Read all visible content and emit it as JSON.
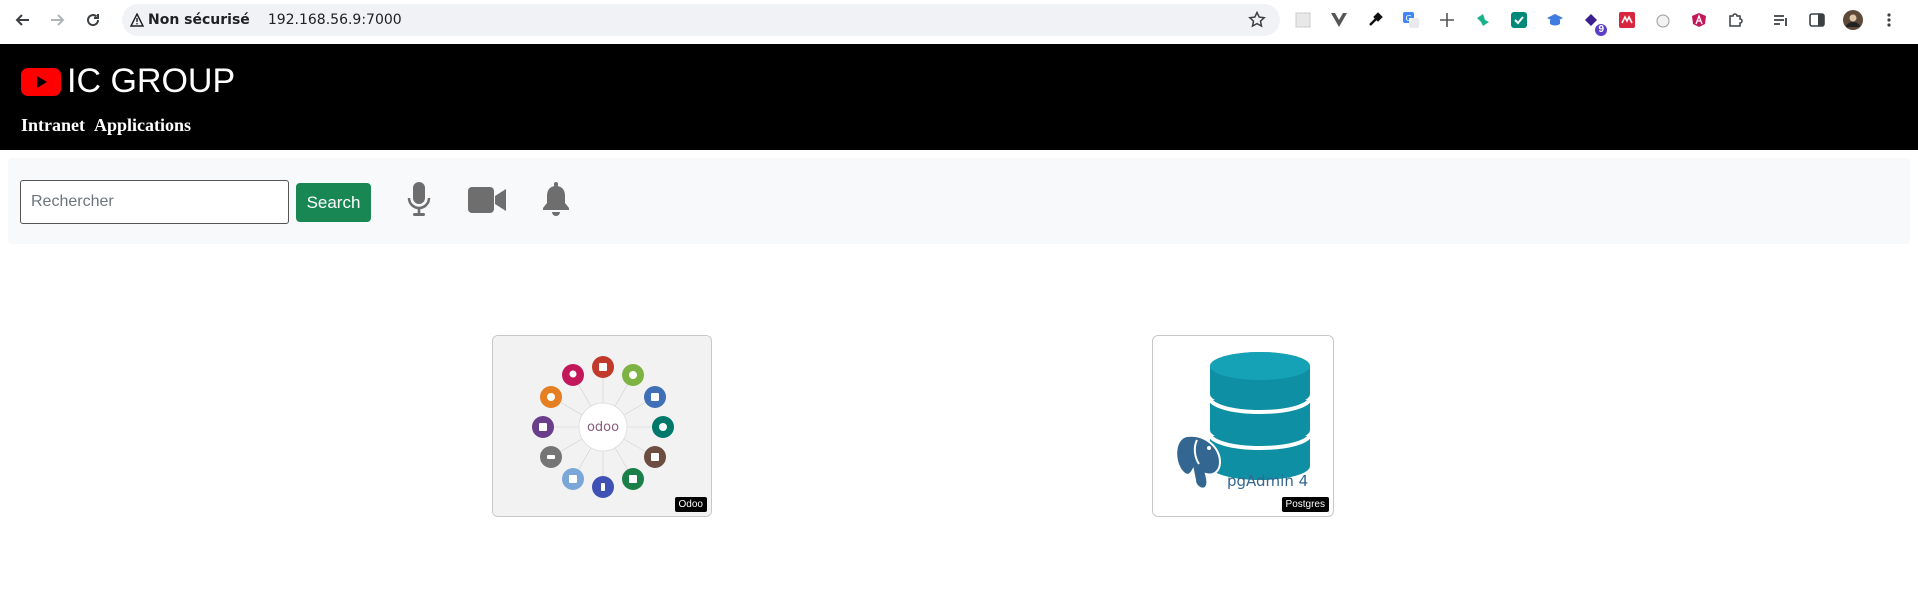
{
  "browser": {
    "security_label": "Non sécurisé",
    "url": "192.168.56.9:7000",
    "extensions": [
      {
        "icon": "grid-icon"
      },
      {
        "icon": "vue-icon"
      },
      {
        "icon": "eyedropper-icon"
      },
      {
        "icon": "translate-icon"
      },
      {
        "icon": "move-icon"
      },
      {
        "icon": "bird-icon"
      },
      {
        "icon": "check-square-icon"
      },
      {
        "icon": "graduation-icon"
      },
      {
        "icon": "puzzle-badge-icon",
        "badge": "9"
      },
      {
        "icon": "red-grid-icon"
      },
      {
        "icon": "cat-icon"
      },
      {
        "icon": "angular-icon"
      },
      {
        "icon": "extensions-icon"
      },
      {
        "icon": "playlist-icon"
      },
      {
        "icon": "sidepanel-icon"
      },
      {
        "icon": "avatar-icon"
      },
      {
        "icon": "kebab-menu-icon"
      }
    ]
  },
  "header": {
    "title": "IC GROUP",
    "nav": [
      "Intranet",
      "Applications"
    ],
    "logo_color": "#ff0000"
  },
  "toolbar": {
    "search_placeholder": "Rechercher",
    "search_button": "Search",
    "icons": [
      "microphone-icon",
      "video-camera-icon",
      "bell-icon"
    ],
    "button_color": "#198754"
  },
  "apps": [
    {
      "label": "Odoo"
    },
    {
      "label": "Postgres",
      "image_text": "pgAdmin 4"
    }
  ]
}
